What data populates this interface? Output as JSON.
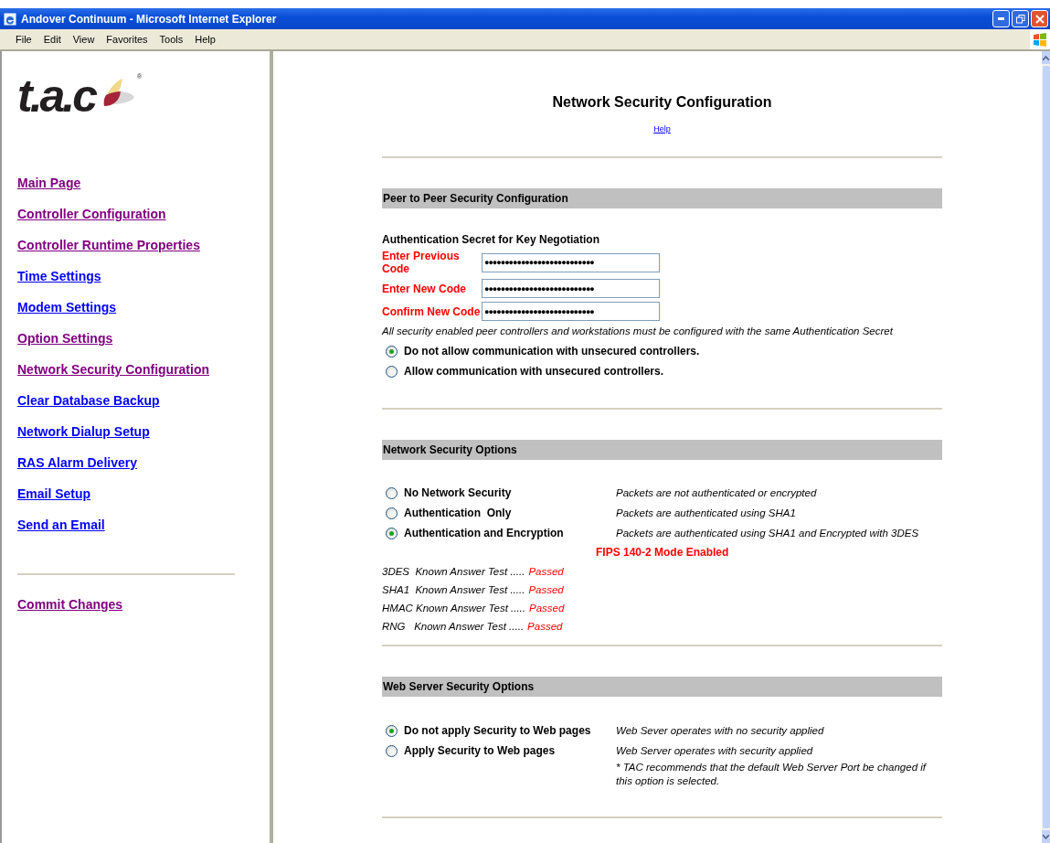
{
  "window": {
    "title": "Andover Continuum - Microsoft Internet Explorer"
  },
  "menu": [
    "File",
    "Edit",
    "View",
    "Favorites",
    "Tools",
    "Help"
  ],
  "logo": {
    "text": "t.a.c",
    "mark": "®"
  },
  "sidebar": {
    "links": [
      {
        "label": "Main Page",
        "visited": true
      },
      {
        "label": "Controller Configuration",
        "visited": true
      },
      {
        "label": "Controller Runtime Properties",
        "visited": true
      },
      {
        "label": "Time Settings",
        "visited": false
      },
      {
        "label": "Modem Settings",
        "visited": false
      },
      {
        "label": "Option Settings",
        "visited": true
      },
      {
        "label": "Network Security Configuration",
        "visited": true
      },
      {
        "label": "Clear Database Backup",
        "visited": false
      },
      {
        "label": "Network Dialup Setup",
        "visited": false
      },
      {
        "label": "RAS Alarm Delivery",
        "visited": false
      },
      {
        "label": "Email Setup",
        "visited": false
      },
      {
        "label": "Send an Email",
        "visited": false
      }
    ],
    "footer_links": [
      {
        "label": "Commit Changes",
        "visited": true
      }
    ]
  },
  "page": {
    "title": "Network Security Configuration",
    "help": "Help"
  },
  "peer_section": {
    "heading": "Peer to Peer Security Configuration",
    "subheading": "Authentication Secret for Key Negotiation",
    "fields": [
      {
        "label": "Enter Previous Code",
        "value": "●●●●●●●●●●●●●●●●●●●●●●●●●●●"
      },
      {
        "label": "Enter New Code",
        "value": "●●●●●●●●●●●●●●●●●●●●●●●●●●●"
      },
      {
        "label": "Confirm New Code",
        "value": "●●●●●●●●●●●●●●●●●●●●●●●●●●●"
      }
    ],
    "note": "All security enabled peer controllers and workstations must be configured with the same Authentication Secret",
    "options": [
      {
        "label": "Do not allow communication with unsecured controllers.",
        "selected": true
      },
      {
        "label": "Allow communication with unsecured controllers.",
        "selected": false
      }
    ]
  },
  "network_section": {
    "heading": "Network Security Options",
    "options": [
      {
        "label": "No Network Security",
        "description": "Packets are not authenticated or encrypted",
        "selected": false
      },
      {
        "label": "Authentication  Only",
        "description": "Packets are authenticated using SHA1",
        "selected": false
      },
      {
        "label": "Authentication and Encryption",
        "description": "Packets are authenticated using SHA1 and Encrypted with 3DES",
        "selected": true
      }
    ],
    "fips": "FIPS 140-2 Mode Enabled",
    "tests": [
      {
        "name": "3DES  Known Answer Test .....",
        "result": "Passed"
      },
      {
        "name": "SHA1  Known Answer Test .....",
        "result": "Passed"
      },
      {
        "name": "HMAC Known Answer Test .....",
        "result": "Passed"
      },
      {
        "name": "RNG   Known Answer Test .....",
        "result": "Passed"
      }
    ]
  },
  "web_section": {
    "heading": "Web Server Security Options",
    "options": [
      {
        "label": "Do not apply Security to Web pages",
        "description": "Web Sever operates with no security applied",
        "selected": true
      },
      {
        "label": "Apply Security to Web pages",
        "description": "Web Server operates with security applied",
        "selected": false
      }
    ],
    "note": "* TAC recommends that the default Web Server Port be changed if this option is selected."
  }
}
